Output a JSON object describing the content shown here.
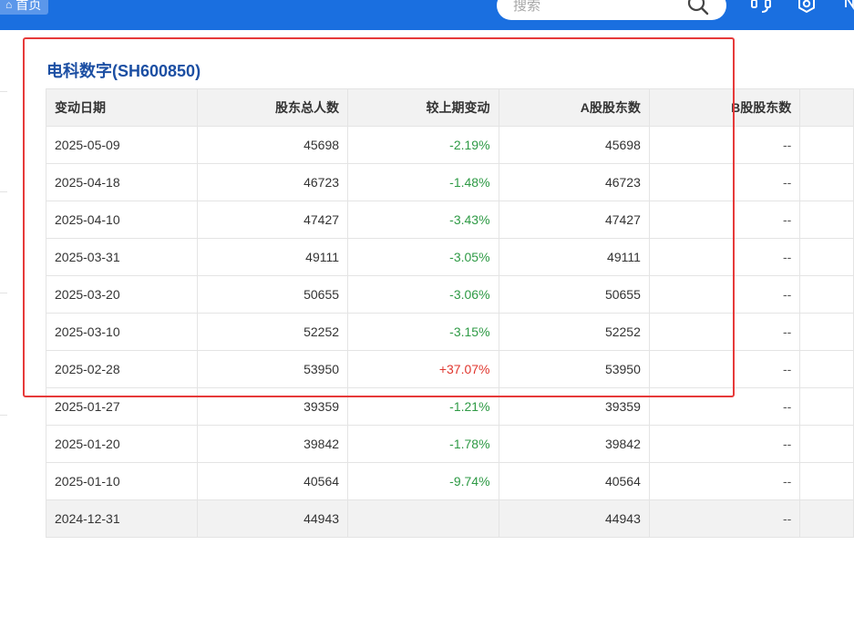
{
  "toolbar": {
    "home_label": "首页",
    "search_placeholder": "搜索",
    "icons": [
      "home-icon",
      "search-icon",
      "headset-icon",
      "settings-icon"
    ]
  },
  "stock": {
    "title": "电科数字(SH600850)"
  },
  "table": {
    "columns": [
      "变动日期",
      "股东总人数",
      "较上期变动",
      "A股股东数",
      "B股股东数"
    ],
    "rows": [
      {
        "date": "2025-05-09",
        "total": "45698",
        "change": "-2.19%",
        "a_shares": "45698",
        "b_shares": "--"
      },
      {
        "date": "2025-04-18",
        "total": "46723",
        "change": "-1.48%",
        "a_shares": "46723",
        "b_shares": "--"
      },
      {
        "date": "2025-04-10",
        "total": "47427",
        "change": "-3.43%",
        "a_shares": "47427",
        "b_shares": "--"
      },
      {
        "date": "2025-03-31",
        "total": "49111",
        "change": "-3.05%",
        "a_shares": "49111",
        "b_shares": "--"
      },
      {
        "date": "2025-03-20",
        "total": "50655",
        "change": "-3.06%",
        "a_shares": "50655",
        "b_shares": "--"
      },
      {
        "date": "2025-03-10",
        "total": "52252",
        "change": "-3.15%",
        "a_shares": "52252",
        "b_shares": "--"
      },
      {
        "date": "2025-02-28",
        "total": "53950",
        "change": "+37.07%",
        "a_shares": "53950",
        "b_shares": "--"
      },
      {
        "date": "2025-01-27",
        "total": "39359",
        "change": "-1.21%",
        "a_shares": "39359",
        "b_shares": "--"
      },
      {
        "date": "2025-01-20",
        "total": "39842",
        "change": "-1.78%",
        "a_shares": "39842",
        "b_shares": "--"
      },
      {
        "date": "2025-01-10",
        "total": "40564",
        "change": "-9.74%",
        "a_shares": "40564",
        "b_shares": "--"
      },
      {
        "date": "2024-12-31",
        "total": "44943",
        "change": "",
        "a_shares": "44943",
        "b_shares": "--"
      }
    ]
  },
  "colors": {
    "topbar": "#1a6fe0",
    "negative_change": "#2e9a45",
    "positive_change": "#e0362e",
    "highlight_frame": "#e63a3a",
    "title": "#1c4fa3"
  }
}
